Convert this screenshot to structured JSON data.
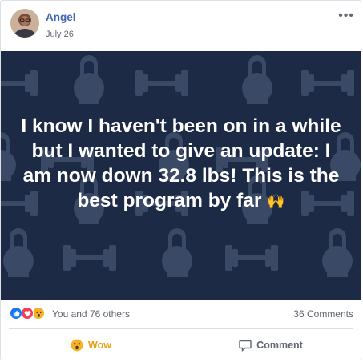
{
  "post": {
    "author": "Angel",
    "date": "July 26",
    "more_label": "•••",
    "hero_text": "I know I haven't been on in a while but I wanted to give an update: I am now down 32.8 lbs! This is the best program by far",
    "hero_emoji": "🙌",
    "background_color": "#1c2a45",
    "pattern_color": "#3a4a66",
    "icons": {
      "avatar": "person-avatar",
      "more": "ellipsis-icon",
      "pattern": [
        "dumbbell-icon",
        "kettlebell-icon"
      ],
      "like": "thumbs-up-icon",
      "love": "heart-icon",
      "wow": "wow-face-icon",
      "comment": "speech-bubble-icon"
    }
  },
  "stats": {
    "reaction_summary": "You and 76 others",
    "comments": "36 Comments"
  },
  "actions": {
    "reaction_label": "Wow",
    "comment_label": "Comment"
  },
  "colors": {
    "link_blue": "#4267b2",
    "wow_yellow": "#e7a217",
    "muted": "#606770"
  }
}
